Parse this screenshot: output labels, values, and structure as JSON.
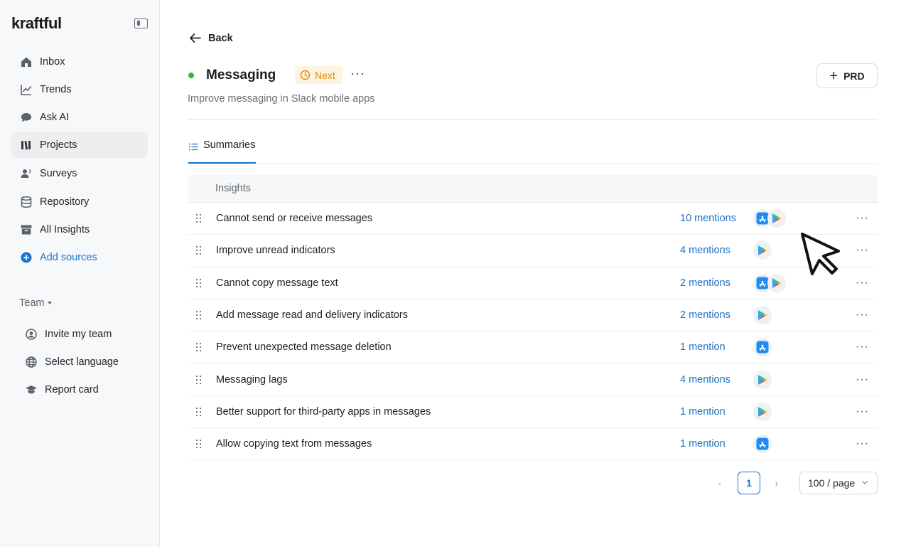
{
  "app": {
    "logo_text": "kraftful"
  },
  "sidebar": {
    "items": [
      {
        "label": "Inbox",
        "icon": "home-icon"
      },
      {
        "label": "Trends",
        "icon": "trend-line-icon"
      },
      {
        "label": "Ask AI",
        "icon": "chat-bubble-icon"
      },
      {
        "label": "Projects",
        "icon": "projects-icon",
        "active": true
      },
      {
        "label": "Surveys",
        "icon": "survey-icon"
      },
      {
        "label": "Repository",
        "icon": "database-icon"
      },
      {
        "label": "All Insights",
        "icon": "archive-icon"
      },
      {
        "label": "Add sources",
        "icon": "plus-circle-icon"
      }
    ],
    "team_label": "Team",
    "team_items": [
      {
        "label": "Invite my team",
        "icon": "invite-user-icon"
      },
      {
        "label": "Select language",
        "icon": "globe-icon"
      },
      {
        "label": "Report card",
        "icon": "graduation-cap-icon"
      }
    ]
  },
  "header": {
    "back_label": "Back",
    "project_title": "Messaging",
    "status_color": "#2db83d",
    "badge_label": "Next",
    "more_label": "···",
    "subtitle": "Improve messaging in Slack mobile apps",
    "prd_button_label": "PRD"
  },
  "tabs": [
    {
      "label": "Summaries",
      "active": true
    }
  ],
  "table": {
    "column_header": "Insights",
    "rows": [
      {
        "insight": "Cannot send or receive messages",
        "mentions": "10 mentions",
        "sources": [
          "app-store",
          "google-play"
        ]
      },
      {
        "insight": "Improve unread indicators",
        "mentions": "4 mentions",
        "sources": [
          "google-play"
        ]
      },
      {
        "insight": "Cannot copy message text",
        "mentions": "2 mentions",
        "sources": [
          "app-store",
          "google-play"
        ]
      },
      {
        "insight": "Add message read and delivery indicators",
        "mentions": "2 mentions",
        "sources": [
          "google-play"
        ]
      },
      {
        "insight": "Prevent unexpected message deletion",
        "mentions": "1 mention",
        "sources": [
          "app-store"
        ]
      },
      {
        "insight": "Messaging lags",
        "mentions": "4 mentions",
        "sources": [
          "google-play"
        ]
      },
      {
        "insight": "Better support for third-party apps in messages",
        "mentions": "1 mention",
        "sources": [
          "google-play"
        ]
      },
      {
        "insight": "Allow copying text from messages",
        "mentions": "1 mention",
        "sources": [
          "app-store"
        ]
      }
    ]
  },
  "pagination": {
    "current_page": "1",
    "page_size": "100 / page"
  },
  "colors": {
    "accent": "#1a73c9",
    "badge_text": "#e08a10",
    "badge_bg": "#fdf3e1"
  }
}
